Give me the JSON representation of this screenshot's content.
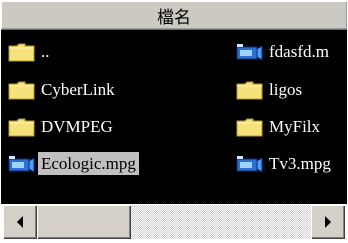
{
  "header": {
    "column_title": "檔名"
  },
  "files": [
    {
      "name": "..",
      "icon": "folder-icon",
      "selected": false
    },
    {
      "name": "CyberLink",
      "icon": "folder-icon",
      "selected": false
    },
    {
      "name": "DVMPEG",
      "icon": "folder-icon",
      "selected": false
    },
    {
      "name": "Ecologic.mpg",
      "icon": "video-file-icon",
      "selected": true
    },
    {
      "name": "fdasfd.m",
      "icon": "video-file-icon",
      "selected": false
    },
    {
      "name": "ligos",
      "icon": "folder-icon",
      "selected": false
    },
    {
      "name": "MyFilx",
      "icon": "folder-icon",
      "selected": false
    },
    {
      "name": "Tv3.mpg",
      "icon": "video-file-icon",
      "selected": false
    }
  ],
  "colors": {
    "background": "#000000",
    "folder": "#f5e27a",
    "selection": "#c0c0c0",
    "header": "#ccc9c2"
  }
}
